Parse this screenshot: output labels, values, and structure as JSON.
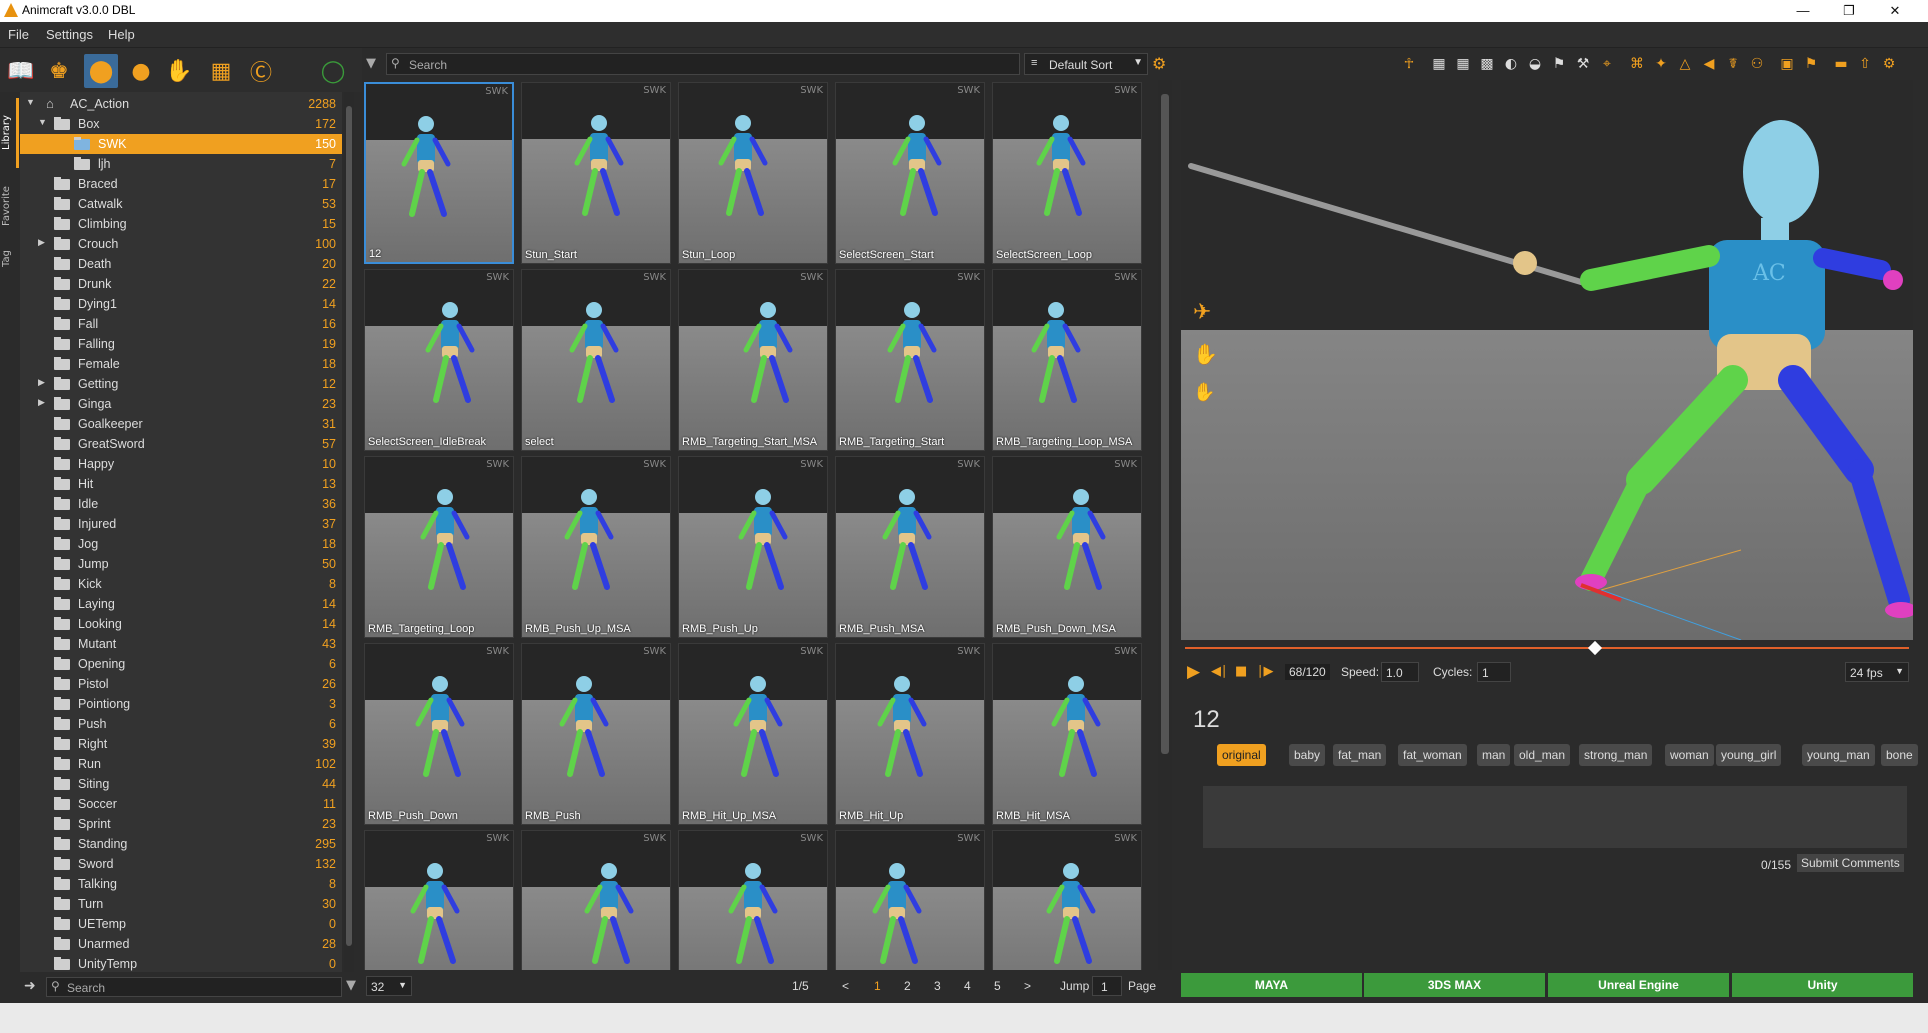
{
  "window": {
    "title": "Animcraft v3.0.0 DBL",
    "minimize": "—",
    "maximize": "❐",
    "close": "✕"
  },
  "menu": [
    "File",
    "Settings",
    "Help"
  ],
  "side_tabs": [
    "Library",
    "Favorite",
    "Tag"
  ],
  "tree": {
    "root": {
      "label": "AC_Action",
      "count": "2288"
    },
    "items": [
      {
        "label": "Box",
        "count": "172",
        "level": 1,
        "expanded": true
      },
      {
        "label": "SWK",
        "count": "150",
        "level": 2,
        "selected": true
      },
      {
        "label": "ljh",
        "count": "7",
        "level": 2
      },
      {
        "label": "Braced",
        "count": "17",
        "level": 1
      },
      {
        "label": "Catwalk",
        "count": "53",
        "level": 1
      },
      {
        "label": "Climbing",
        "count": "15",
        "level": 1
      },
      {
        "label": "Crouch",
        "count": "100",
        "level": 1,
        "collapsed": true
      },
      {
        "label": "Death",
        "count": "20",
        "level": 1
      },
      {
        "label": "Drunk",
        "count": "22",
        "level": 1
      },
      {
        "label": "Dying1",
        "count": "14",
        "level": 1
      },
      {
        "label": "Fall",
        "count": "16",
        "level": 1
      },
      {
        "label": "Falling",
        "count": "19",
        "level": 1
      },
      {
        "label": "Female",
        "count": "18",
        "level": 1
      },
      {
        "label": "Getting",
        "count": "12",
        "level": 1,
        "collapsed": true
      },
      {
        "label": "Ginga",
        "count": "23",
        "level": 1,
        "collapsed": true
      },
      {
        "label": "Goalkeeper",
        "count": "31",
        "level": 1
      },
      {
        "label": "GreatSword",
        "count": "57",
        "level": 1
      },
      {
        "label": "Happy",
        "count": "10",
        "level": 1
      },
      {
        "label": "Hit",
        "count": "13",
        "level": 1
      },
      {
        "label": "Idle",
        "count": "36",
        "level": 1
      },
      {
        "label": "Injured",
        "count": "37",
        "level": 1
      },
      {
        "label": "Jog",
        "count": "18",
        "level": 1
      },
      {
        "label": "Jump",
        "count": "50",
        "level": 1
      },
      {
        "label": "Kick",
        "count": "8",
        "level": 1
      },
      {
        "label": "Laying",
        "count": "14",
        "level": 1
      },
      {
        "label": "Looking",
        "count": "14",
        "level": 1
      },
      {
        "label": "Mutant",
        "count": "43",
        "level": 1
      },
      {
        "label": "Opening",
        "count": "6",
        "level": 1
      },
      {
        "label": "Pistol",
        "count": "26",
        "level": 1
      },
      {
        "label": "Pointiong",
        "count": "3",
        "level": 1
      },
      {
        "label": "Push",
        "count": "6",
        "level": 1
      },
      {
        "label": "Right",
        "count": "39",
        "level": 1
      },
      {
        "label": "Run",
        "count": "102",
        "level": 1
      },
      {
        "label": "Siting",
        "count": "44",
        "level": 1
      },
      {
        "label": "Soccer",
        "count": "11",
        "level": 1
      },
      {
        "label": "Sprint",
        "count": "23",
        "level": 1
      },
      {
        "label": "Standing",
        "count": "295",
        "level": 1
      },
      {
        "label": "Sword",
        "count": "132",
        "level": 1
      },
      {
        "label": "Talking",
        "count": "8",
        "level": 1
      },
      {
        "label": "Turn",
        "count": "30",
        "level": 1
      },
      {
        "label": "UETemp",
        "count": "0",
        "level": 1
      },
      {
        "label": "Unarmed",
        "count": "28",
        "level": 1
      },
      {
        "label": "UnityTemp",
        "count": "0",
        "level": 1
      }
    ],
    "search_placeholder": "Search"
  },
  "grid": {
    "search_placeholder": "Search",
    "sort": "Default Sort",
    "tag": "SWK",
    "items": [
      "12",
      "Stun_Start",
      "Stun_Loop",
      "SelectScreen_Start",
      "SelectScreen_Loop",
      "SelectScreen_IdleBreak",
      "select",
      "RMB_Targeting_Start_MSA",
      "RMB_Targeting_Start",
      "RMB_Targeting_Loop_MSA",
      "RMB_Targeting_Loop",
      "RMB_Push_Up_MSA",
      "RMB_Push_Up",
      "RMB_Push_MSA",
      "RMB_Push_Down_MSA",
      "RMB_Push_Down",
      "RMB_Push",
      "RMB_Hit_Up_MSA",
      "RMB_Hit_Up",
      "RMB_Hit_MSA",
      "",
      "",
      "",
      "",
      ""
    ],
    "selected_index": 0
  },
  "pager": {
    "per_page": "32",
    "page_info": "1/5",
    "prev": "<",
    "pages": [
      "1",
      "2",
      "3",
      "4",
      "5"
    ],
    "current": "1",
    "next": ">",
    "jump_label": "Jump",
    "jump_value": "1",
    "page_label": "Page"
  },
  "viewer": {
    "frame": "68/120",
    "frame_progress": 0.5667,
    "speed_label": "Speed:",
    "speed": "1.0",
    "cycles_label": "Cycles:",
    "cycles": "1",
    "fps": "24 fps",
    "chest_text": "AC"
  },
  "info": {
    "title": "12",
    "characters": [
      "original",
      "baby",
      "fat_man",
      "fat_woman",
      "man",
      "old_man",
      "strong_man",
      "woman",
      "young_girl",
      "young_man",
      "bone"
    ],
    "active_character": "original",
    "comment_count": "0/155",
    "submit": "Submit Comments"
  },
  "export": [
    "MAYA",
    "3DS MAX",
    "Unreal Engine",
    "Unity"
  ],
  "colors": {
    "accent": "#f0a020",
    "export": "#3c9a3c",
    "select": "#3a8dd8"
  }
}
